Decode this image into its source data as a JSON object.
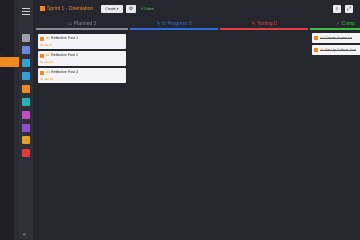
{
  "sidebar": {
    "sel_label": "...",
    "labels": [
      "..",
      ".."
    ],
    "rail": [
      {
        "name": "grid-icon",
        "color": "#9aa0a8"
      },
      {
        "name": "people-icon",
        "color": "#6a8ad8"
      },
      {
        "name": "chat-icon",
        "color": "#2fa3d8"
      },
      {
        "name": "app-icon",
        "color": "#2fa3d8"
      },
      {
        "name": "edit-icon",
        "color": "#f08a1c"
      },
      {
        "name": "check-icon",
        "color": "#27b3b0"
      },
      {
        "name": "puzzle-icon",
        "color": "#c24fc2"
      },
      {
        "name": "user-icon",
        "color": "#8f4fd0"
      },
      {
        "name": "doc-icon",
        "color": "#e0a020"
      },
      {
        "name": "briefcase-icon",
        "color": "#e53935"
      }
    ],
    "collapse_label": "«"
  },
  "toolbar": {
    "title": "Sprint 1 - Orientation",
    "create_label": "Create ▾",
    "online_label": "0 Online"
  },
  "columns": [
    {
      "label": "Planned",
      "count": "3",
      "color": "#8a8a96"
    },
    {
      "label": "In Progress",
      "count": "0",
      "color": "#2b6fd8"
    },
    {
      "label": "Testing",
      "count": "0",
      "color": "#e0413f"
    },
    {
      "label": "Comp",
      "count": "",
      "color": "#3fbf3f"
    }
  ],
  "cards_planned": [
    {
      "id": "#1",
      "title": "Reflective Post 1",
      "date": "01 Jan 8"
    },
    {
      "id": "#2",
      "title": "Reflective Post 2",
      "date": "01 Jan 11"
    },
    {
      "id": "#3",
      "title": "Reflective Post 3",
      "date": "01 Jan 16"
    }
  ],
  "cards_complete": [
    {
      "id": "#4",
      "title": "Create Avatar for"
    },
    {
      "id": "#5",
      "title": "Set Up Critical Jour"
    }
  ]
}
